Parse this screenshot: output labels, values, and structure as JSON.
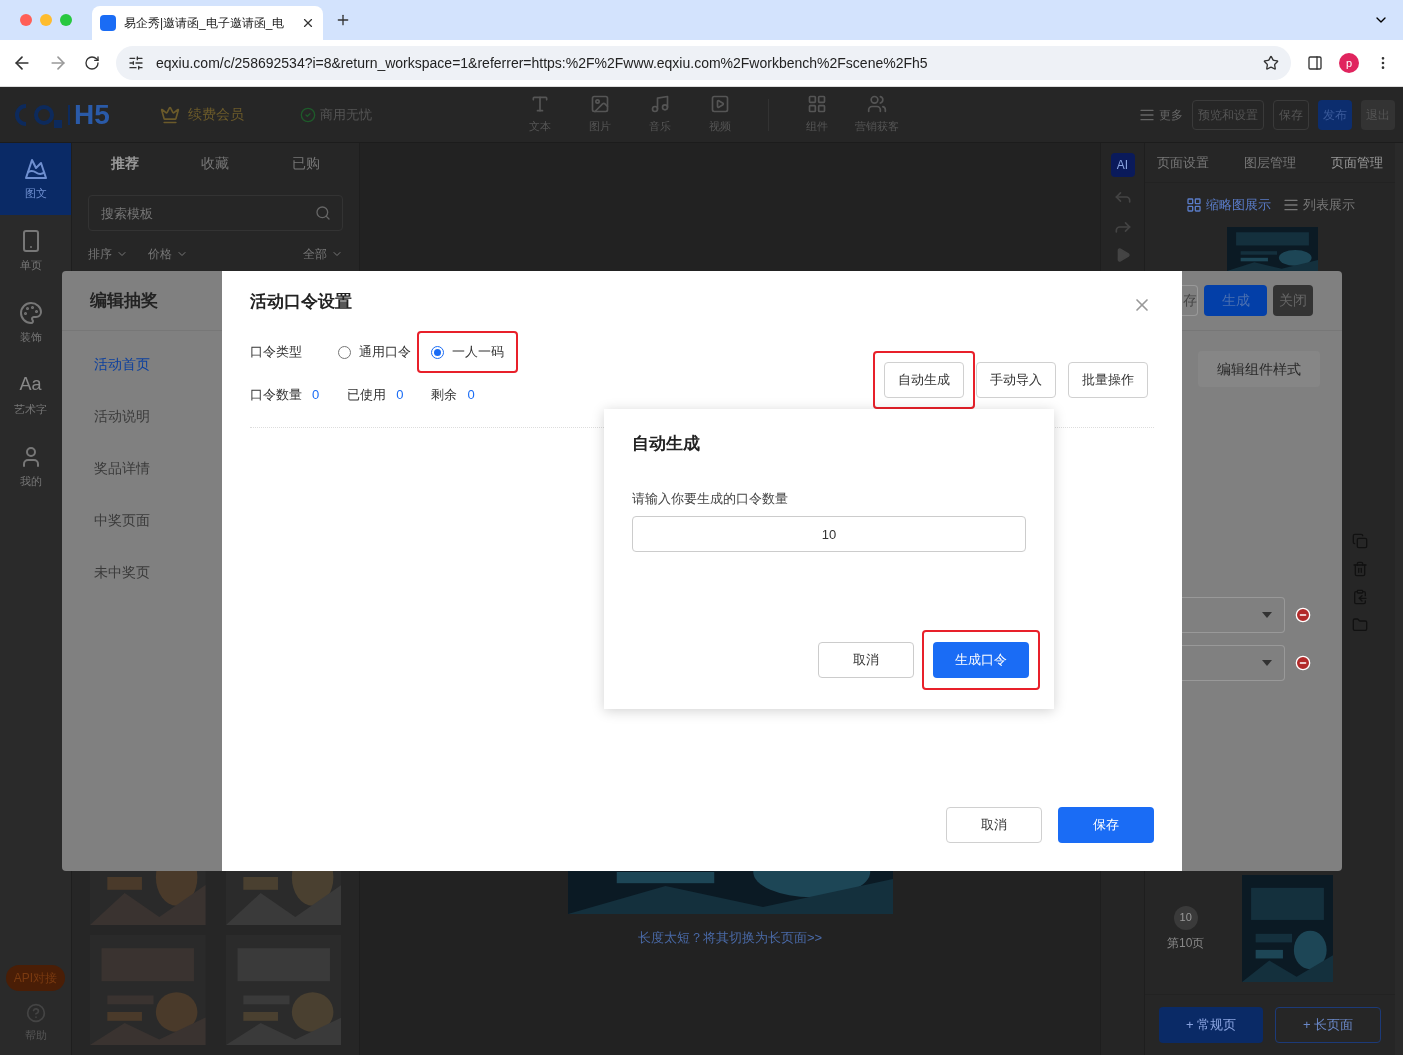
{
  "browser": {
    "tab_title": "易企秀|邀请函_电子邀请函_电",
    "url": "eqxiu.com/c/258692534?i=8&return_workspace=1&referrer=https:%2F%2Fwww.eqxiu.com%2Fworkbench%2Fscene%2Fh5",
    "profile_initial": "p"
  },
  "app_header": {
    "logo": "H5",
    "membership": "续费会员",
    "commercial": "商用无忧",
    "tool_groups": [
      {
        "tools": [
          {
            "label": "文本"
          },
          {
            "label": "图片"
          },
          {
            "label": "音乐"
          },
          {
            "label": "视频"
          }
        ]
      },
      {
        "tools": [
          {
            "label": "组件"
          },
          {
            "label": "营销获客"
          }
        ]
      }
    ],
    "more": "更多",
    "actions": [
      {
        "label": "预览和设置",
        "kind": "outline"
      },
      {
        "label": "保存",
        "kind": "outline"
      },
      {
        "label": "发布",
        "kind": "primary"
      },
      {
        "label": "退出",
        "kind": "dark"
      }
    ]
  },
  "side_rail": {
    "items": [
      {
        "label": "图文",
        "selected": true
      },
      {
        "label": "单页",
        "selected": false
      },
      {
        "label": "装饰",
        "selected": false
      },
      {
        "label": "艺术字",
        "glyph": "Aa",
        "selected": false
      },
      {
        "label": "我的",
        "selected": false
      }
    ],
    "api_badge": "API对接",
    "help": "帮助"
  },
  "template_panel": {
    "tabs": [
      {
        "label": "推荐",
        "selected": true
      },
      {
        "label": "收藏",
        "selected": false
      },
      {
        "label": "已购",
        "selected": false
      }
    ],
    "search": {
      "placeholder": "搜索模板"
    },
    "filters": [
      {
        "label": "排序"
      },
      {
        "label": "价格"
      },
      {
        "label": "全部"
      }
    ]
  },
  "ai_button": "AI",
  "stage": {
    "switch_link": "长度太短？将其切换为长页面>>"
  },
  "right_panel": {
    "tabs": [
      {
        "label": "页面设置",
        "selected": false
      },
      {
        "label": "图层管理",
        "selected": false
      },
      {
        "label": "页面管理",
        "selected": true
      }
    ],
    "views": [
      {
        "label": "缩略图展示",
        "selected": true
      },
      {
        "label": "列表展示",
        "selected": false
      }
    ],
    "page": {
      "badge": "10",
      "label": "第10页"
    },
    "add_buttons": [
      {
        "label": "+ 常规页",
        "kind": "primary"
      },
      {
        "label": "+ 长页面",
        "kind": "outline"
      }
    ]
  },
  "lottery_panel": {
    "title": "编辑抽奖",
    "nav": [
      {
        "label": "活动首页",
        "selected": true
      },
      {
        "label": "活动说明",
        "selected": false
      },
      {
        "label": "奖品详情",
        "selected": false
      },
      {
        "label": "中奖页面",
        "selected": false
      },
      {
        "label": "未中奖页",
        "selected": false
      }
    ],
    "header_buttons": [
      {
        "label": "存",
        "kind": "outline"
      },
      {
        "label": "生成",
        "kind": "primary"
      },
      {
        "label": "关闭",
        "kind": "dark"
      }
    ],
    "style_button": "编辑组件样式"
  },
  "code_dialog": {
    "title": "活动口令设置",
    "type_label": "口令类型",
    "options": [
      {
        "label": "通用口令",
        "selected": false,
        "highlighted": false
      },
      {
        "label": "一人一码",
        "selected": true,
        "highlighted": true
      }
    ],
    "stats": [
      {
        "label": "口令数量",
        "value": "0"
      },
      {
        "label": "已使用",
        "value": "0"
      },
      {
        "label": "剩余",
        "value": "0"
      }
    ],
    "actions": [
      {
        "label": "自动生成",
        "highlighted": true
      },
      {
        "label": "手动导入",
        "highlighted": false
      },
      {
        "label": "批量操作",
        "highlighted": false
      }
    ],
    "cancel": "取消",
    "save": "保存"
  },
  "auto_popup": {
    "title": "自动生成",
    "prompt": "请输入你要生成的口令数量",
    "value": "10",
    "cancel": "取消",
    "confirm": {
      "label": "生成口令",
      "highlighted": true
    }
  }
}
